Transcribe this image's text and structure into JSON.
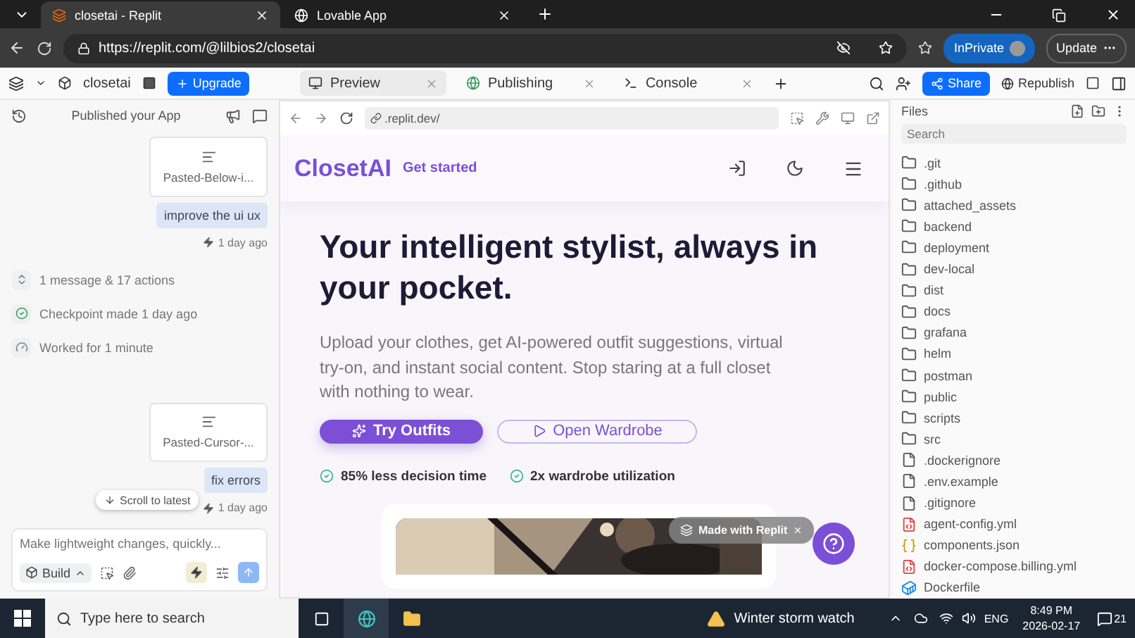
{
  "browser": {
    "tabs": [
      {
        "title": "closetai - Replit",
        "selected": true
      },
      {
        "title": "Lovable App",
        "selected": false
      }
    ],
    "address": "https://replit.com/@lilbios2/closetai",
    "profile": "InPrivate",
    "update": "Update"
  },
  "toolbar": {
    "project": "closetai",
    "upgrade": "Upgrade",
    "tabs": [
      {
        "label": "Preview",
        "selected": true
      },
      {
        "label": "Publishing",
        "selected": false
      },
      {
        "label": "Console",
        "selected": false
      }
    ],
    "share": "Share",
    "republish": "Republish"
  },
  "chat": {
    "title": "Published your App",
    "messages": [
      {
        "kind": "attachment",
        "text": "Pasted-Below-i..."
      },
      {
        "kind": "user",
        "text": "improve the ui ux",
        "time": "1 day ago"
      },
      {
        "kind": "actions",
        "text": "1 message & 17 actions"
      },
      {
        "kind": "checkpoint",
        "text": "Checkpoint made 1 day ago"
      },
      {
        "kind": "duration",
        "text": "Worked for 1 minute"
      },
      {
        "kind": "attachment",
        "text": "Pasted-Cursor-..."
      },
      {
        "kind": "user",
        "text": "fix errors",
        "time": "1 day ago"
      }
    ],
    "scroll_to_latest": "Scroll to latest",
    "composer": {
      "placeholder": "Make lightweight changes, quickly..."
    },
    "mode": "Build"
  },
  "preview": {
    "url": ".replit.dev/",
    "site": {
      "brand": "ClosetAI",
      "get_started": "Get started",
      "headline": "Your intelligent stylist, always in your pocket.",
      "subtitle": "Upload your clothes, get AI-powered outfit suggestions, virtual try-on, and instant social content. Stop staring at a full closet with nothing to wear.",
      "primary": "Try Outfits",
      "secondary": "Open Wardrobe",
      "stats": [
        "85% less decision time",
        "2x wardrobe utilization"
      ]
    },
    "badge": "Made with Replit"
  },
  "files": {
    "title": "Files",
    "search": {
      "placeholder": "Search"
    },
    "items": [
      {
        "name": ".git",
        "kind": "folder"
      },
      {
        "name": ".github",
        "kind": "folder"
      },
      {
        "name": "attached_assets",
        "kind": "folder"
      },
      {
        "name": "backend",
        "kind": "folder"
      },
      {
        "name": "deployment",
        "kind": "folder"
      },
      {
        "name": "dev-local",
        "kind": "folder"
      },
      {
        "name": "dist",
        "kind": "folder"
      },
      {
        "name": "docs",
        "kind": "folder"
      },
      {
        "name": "grafana",
        "kind": "folder"
      },
      {
        "name": "helm",
        "kind": "folder"
      },
      {
        "name": "postman",
        "kind": "folder"
      },
      {
        "name": "public",
        "kind": "folder"
      },
      {
        "name": "scripts",
        "kind": "folder"
      },
      {
        "name": "src",
        "kind": "folder"
      },
      {
        "name": ".dockerignore",
        "kind": "file"
      },
      {
        "name": ".env.example",
        "kind": "file"
      },
      {
        "name": ".gitignore",
        "kind": "file"
      },
      {
        "name": "agent-config.yml",
        "kind": "yaml"
      },
      {
        "name": "components.json",
        "kind": "json"
      },
      {
        "name": "docker-compose.billing.yml",
        "kind": "yaml"
      },
      {
        "name": "Dockerfile",
        "kind": "docker"
      }
    ]
  },
  "taskbar": {
    "search": {
      "placeholder": "Type here to search"
    },
    "weather": "Winter storm watch",
    "language": "ENG",
    "time": "8:49 PM",
    "date": "2026-02-17",
    "notifications": "21"
  }
}
